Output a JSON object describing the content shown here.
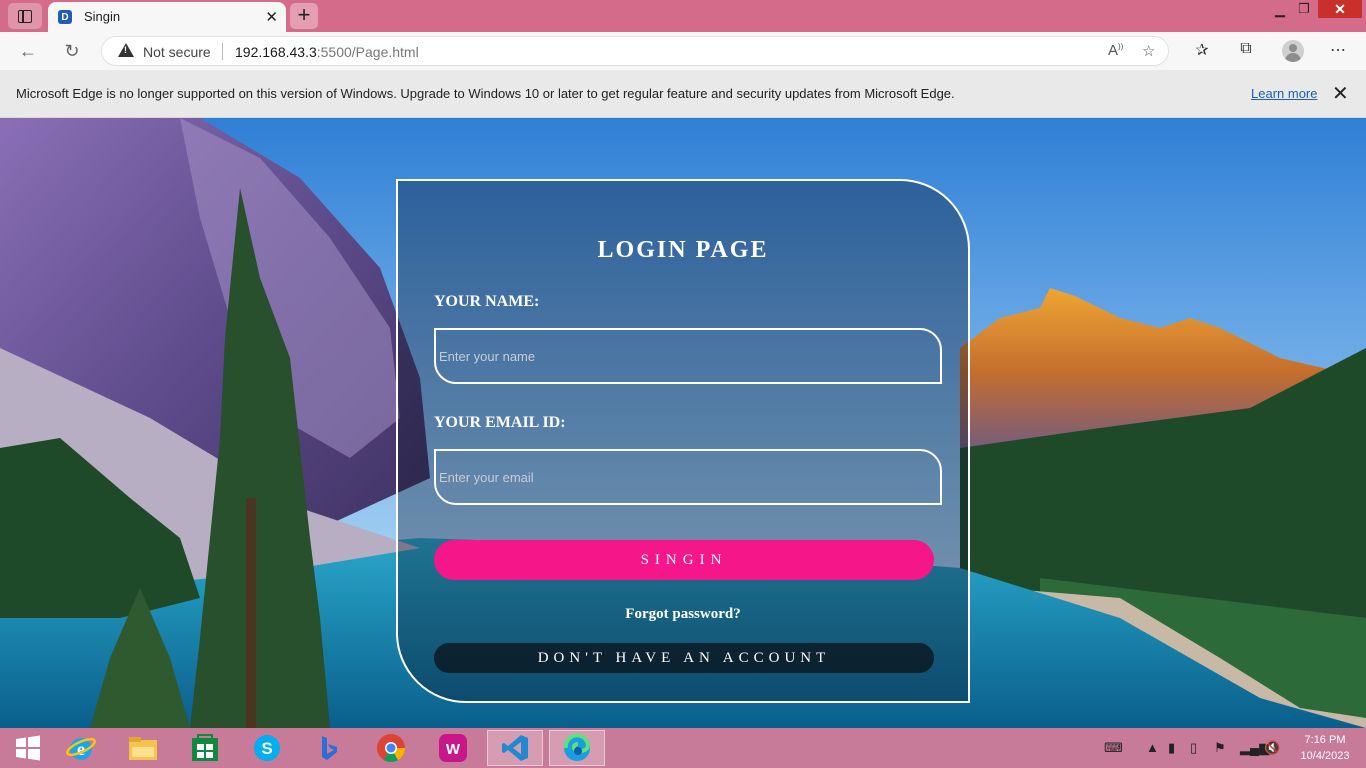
{
  "browser": {
    "tab_title": "Singin",
    "tab_favicon_letter": "D",
    "security_label": "Not secure",
    "url_host": "192.168.43.3",
    "url_rest": ":5500/Page.html",
    "infobar_message": "Microsoft Edge is no longer supported on this version of Windows. Upgrade to Windows 10 or later to get regular feature and security updates from Microsoft Edge.",
    "infobar_link": "Learn more"
  },
  "login": {
    "title": "LOGIN PAGE",
    "name_label": "YOUR NAME:",
    "name_placeholder": "Enter your name",
    "email_label": "YOUR EMAIL ID:",
    "email_placeholder": "Enter your email",
    "signin_label": "SINGIN",
    "forgot_label": "Forgot password?",
    "no_account_label": "DON'T HAVE AN ACCOUNT",
    "signin_color": "#f5168a"
  },
  "taskbar": {
    "time": "7:16 PM",
    "date": "10/4/2023",
    "apps": [
      "start-icon",
      "internet-explorer-icon",
      "file-explorer-icon",
      "store-icon",
      "skype-icon",
      "bing-icon",
      "chrome-icon",
      "wps-office-icon",
      "vscode-icon",
      "edge-icon"
    ]
  },
  "colors": {
    "tabstrip": "#d56b8a",
    "taskbar": "#c77b98",
    "accent": "#f5168a"
  }
}
